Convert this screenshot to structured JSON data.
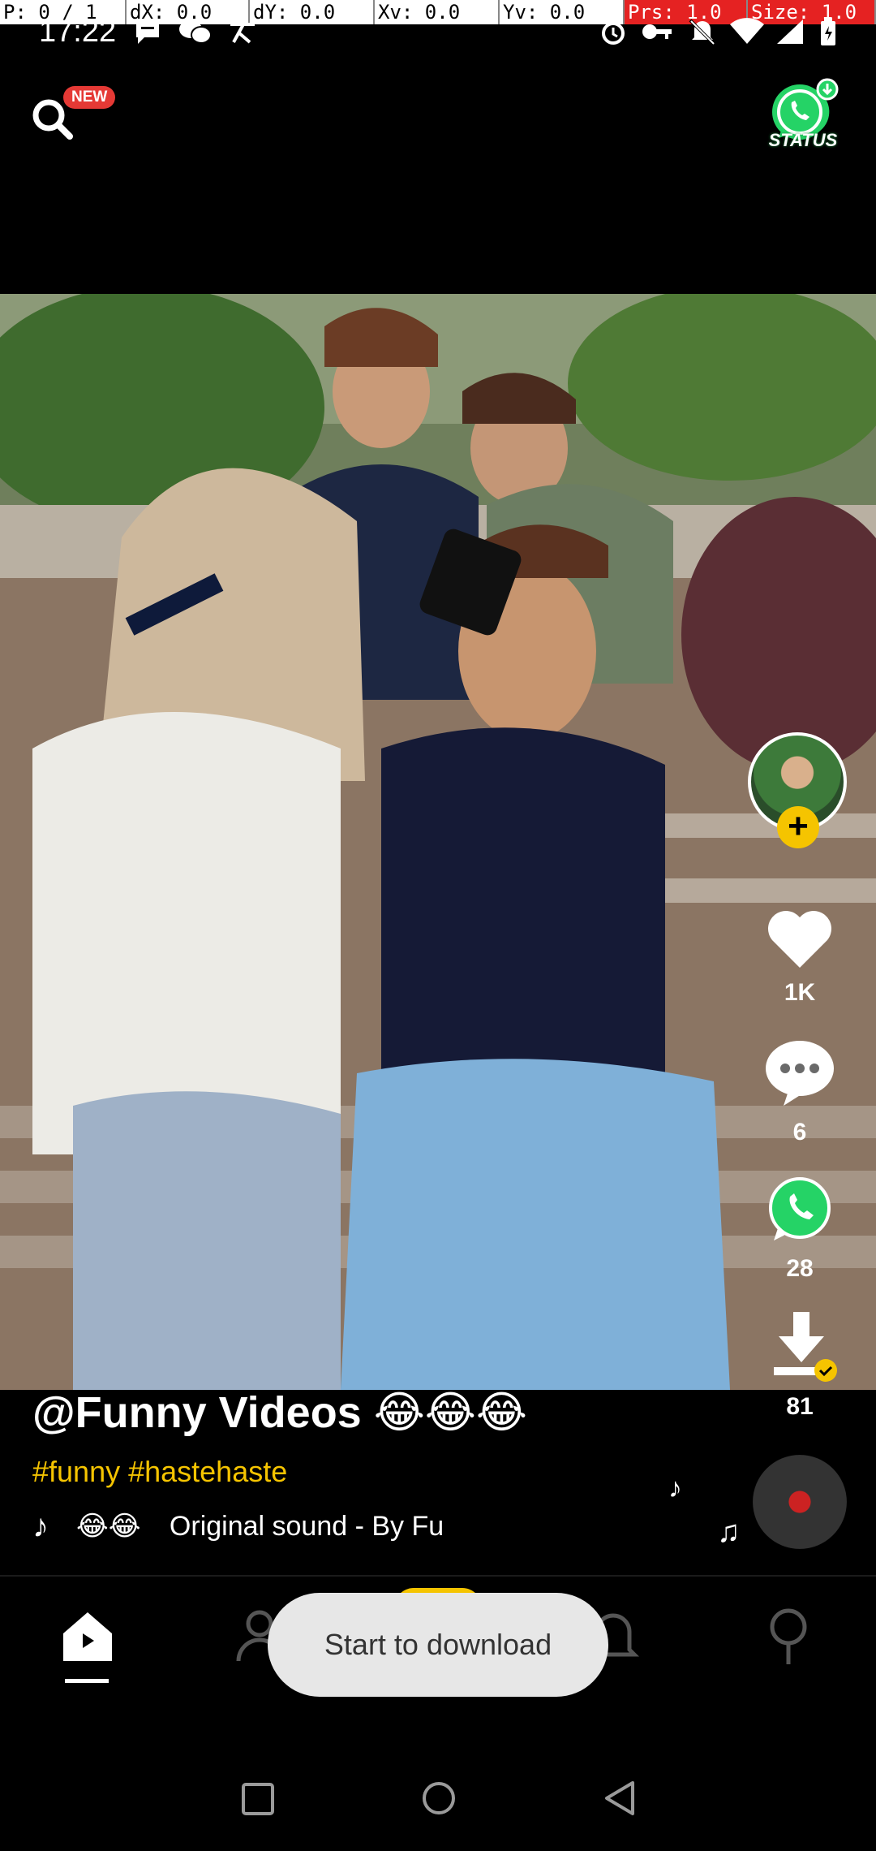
{
  "debug_bar": {
    "pointer": "P: 0 / 1",
    "dx": "dX: 0.0",
    "dy": "dY: 0.0",
    "xv": "Xv: 0.0",
    "yv": "Yv: 0.0",
    "prs": "Prs: 1.0",
    "size": "Size: 1.0"
  },
  "status_bar": {
    "time": "17:22",
    "icons": [
      "message-icon",
      "wechat-icon",
      "translate-icon",
      "alarm-icon",
      "key-icon",
      "mute-icon",
      "wifi-icon",
      "signal-icon",
      "battery-icon"
    ]
  },
  "top_bar": {
    "search_icon": "search-icon",
    "new_badge": "NEW",
    "status_label": "STATUS"
  },
  "rail": {
    "likes": "1K",
    "comments": "6",
    "shares": "28",
    "downloads": "81"
  },
  "caption": {
    "author": "@Funny Videos 😂😂😂",
    "hashtags": "#funny #hastehaste",
    "sound_emoji": "😂😂",
    "sound": "Original sound - By Fu"
  },
  "toast": {
    "message": "Start to download"
  },
  "bottom_nav": {
    "items": [
      "home-icon",
      "following-icon",
      "create-icon",
      "notification-icon",
      "profile-icon"
    ]
  },
  "colors": {
    "accent": "#f5c400",
    "badge": "#e53935",
    "whatsapp": "#25d366",
    "toast_bg": "#e7e7e7"
  }
}
